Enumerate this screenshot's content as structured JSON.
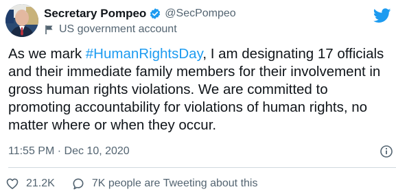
{
  "author": {
    "name": "Secretary Pompeo",
    "handle": "@SecPompeo",
    "account_label": "US government account",
    "verified": true
  },
  "tweet": {
    "text_before": "As we mark ",
    "hashtag": "#HumanRightsDay",
    "text_after": ", I am designating 17 officials and their immediate family members for their involvement in gross human rights violations. We are committed to promoting accountability for violations of human rights, no matter where or when they occur.",
    "timestamp": "11:55 PM · Dec 10, 2020"
  },
  "actions": {
    "likes": "21.2K",
    "reply_text": "7K people are Tweeting about this"
  },
  "colors": {
    "link": "#1d9bf0",
    "secondary_text": "#536471",
    "divider": "#cfd9de"
  },
  "icons": [
    "verified-badge-icon",
    "flag-icon",
    "twitter-bird-icon",
    "info-icon",
    "heart-icon",
    "speech-bubble-icon"
  ]
}
